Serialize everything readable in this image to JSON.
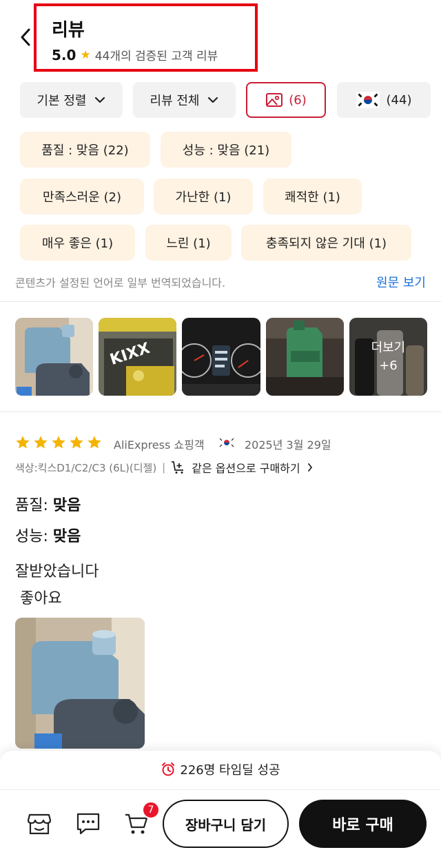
{
  "header": {
    "title": "리뷰",
    "rating": "5.0",
    "review_count_text": "44개의 검증된 고객 리뷰"
  },
  "filters": {
    "sort_label": "기본 정렬",
    "scope_label": "리뷰 전체",
    "photo_count": "(6)",
    "country_count": "(44)"
  },
  "tags": [
    "품질 : 맞음 (22)",
    "성능 : 맞음 (21)",
    "만족스러운 (2)",
    "가난한 (1)",
    "쾌적한 (1)",
    "매우 좋은 (1)",
    "느린 (1)",
    "충족되지 않은 기대 (1)"
  ],
  "translation": {
    "notice": "콘텐츠가 설정된 언어로 일부 번역되었습니다.",
    "original_link": "원문 보기"
  },
  "photos": {
    "more_label": "더보기",
    "more_count": "+6",
    "thumb_brand": "KIXX"
  },
  "review": {
    "star_rating": 5,
    "reviewer": "AliExpress 쇼핑객",
    "date": "2025년 3월 29일",
    "option": "색상:킥스D1/C2/C3 (6L)(디젤)",
    "buy_same": "같은 옵션으로 구매하기",
    "quality_key": "품질: ",
    "quality_value": "맞음",
    "performance_key": "성능: ",
    "performance_value": "맞음",
    "text_line1": "잘받았습니다",
    "text_line2": " 좋아요"
  },
  "bottom": {
    "timedeal": "226명 타임딜 성공",
    "cart_badge": "7",
    "add_to_cart": "장바구니 담기",
    "buy_now": "바로 구매"
  },
  "colors": {
    "accent_red": "#e60012",
    "photo_chip": "#c81d35",
    "tag_bg": "#fff3e3",
    "link_blue": "#1a6fd8",
    "star": "#f5b400"
  }
}
